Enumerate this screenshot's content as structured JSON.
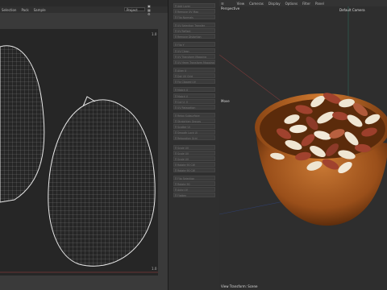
{
  "uv_editor": {
    "menu": [
      "Selection",
      "Pack",
      "Sample"
    ],
    "mode_dropdown": "Project",
    "corner_top": "1.0",
    "corner_bottom": "1.0"
  },
  "commands": [
    "Add Layer",
    "Remove UV Map",
    "Flip Normals",
    "UV Selection Transfer",
    "UV Reflect",
    "Remove Distortion",
    "Flip Y",
    "UV Clean",
    "UV Transform Mapping",
    "UV Hmm Transform Mapping",
    "Align U",
    "Dot UV Grid",
    "Fix Clipped UV",
    "Match U",
    "Match V",
    "Cut U, V",
    "UV Relaxation",
    "Relax Subsurface",
    "Straighten Groups",
    "Scatter Ui",
    "Smooth Lock Ui",
    "Relaxation Grid",
    "Scale UV",
    "Scale UV",
    "Scale UV",
    "Rotate 90 CW",
    "Rotate 90 CW",
    "Flip Selection",
    "Rotate 90",
    "Auto UV",
    "Flatten"
  ],
  "viewport": {
    "menu": [
      "View",
      "Cameras",
      "Display",
      "Options",
      "Filter",
      "Panel"
    ],
    "projection_label": "Perspective",
    "camera_label": "Default Camera",
    "axis_label": "Move",
    "status_label": "View Transform: Scene"
  },
  "colors": {
    "bowl": "#a85a1f",
    "bowl_rim": "#c26a26",
    "uv_line": "#e8e8e8",
    "nut_shell": "#a0422e",
    "nut_meat": "#efe5d2"
  }
}
